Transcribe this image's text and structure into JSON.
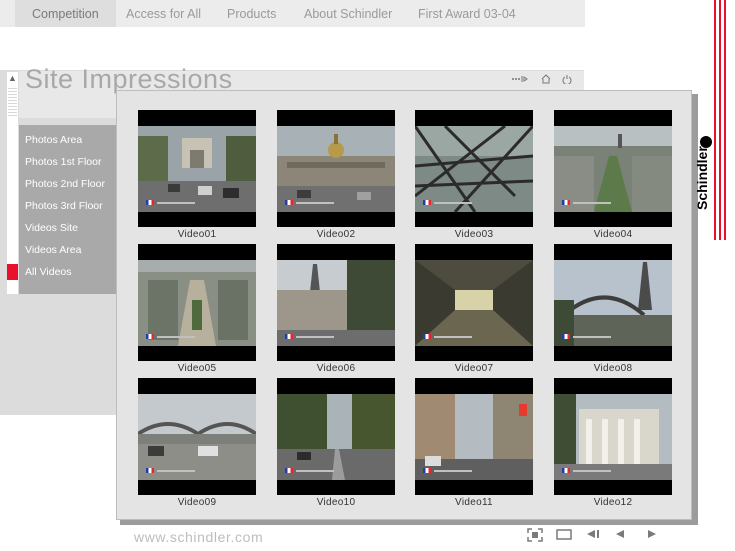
{
  "nav": {
    "items": [
      "Competition",
      "Access for All",
      "Products",
      "About Schindler",
      "First Award 03-04"
    ],
    "active": "Competition"
  },
  "page_title": "Site Impressions",
  "menu": {
    "items": [
      "Photos Area",
      "Photos 1st Floor",
      "Photos 2nd Floor",
      "Photos 3rd Floor",
      "Videos Site",
      "Videos Area",
      "All Videos"
    ],
    "selected": "All Videos"
  },
  "gallery": {
    "videos": [
      {
        "title": "Video01",
        "scene": "arch-avenue"
      },
      {
        "title": "Video02",
        "scene": "dome-building"
      },
      {
        "title": "Video03",
        "scene": "tower-structure"
      },
      {
        "title": "Video04",
        "scene": "aerial-field"
      },
      {
        "title": "Video05",
        "scene": "aerial-plaza"
      },
      {
        "title": "Video06",
        "scene": "tower-trees"
      },
      {
        "title": "Video07",
        "scene": "tunnel"
      },
      {
        "title": "Video08",
        "scene": "bridge-tower"
      },
      {
        "title": "Video09",
        "scene": "bridge-river"
      },
      {
        "title": "Video10",
        "scene": "street-trees"
      },
      {
        "title": "Video11",
        "scene": "city-street"
      },
      {
        "title": "Video12",
        "scene": "columns-building"
      }
    ]
  },
  "brand": {
    "name": "Schindler"
  },
  "footer": {
    "url": "www.schindler.com"
  },
  "controls": {
    "icons": [
      "fullscreen-icon",
      "window-icon",
      "rewind-icon",
      "previous-icon",
      "next-icon"
    ]
  },
  "toolbar": {
    "icons": [
      "sound-icon",
      "home-icon",
      "power-icon"
    ]
  },
  "colors": {
    "accent": "#e8102a",
    "menu_bg": "#a9a9a9",
    "nav_bg": "#ececec"
  }
}
